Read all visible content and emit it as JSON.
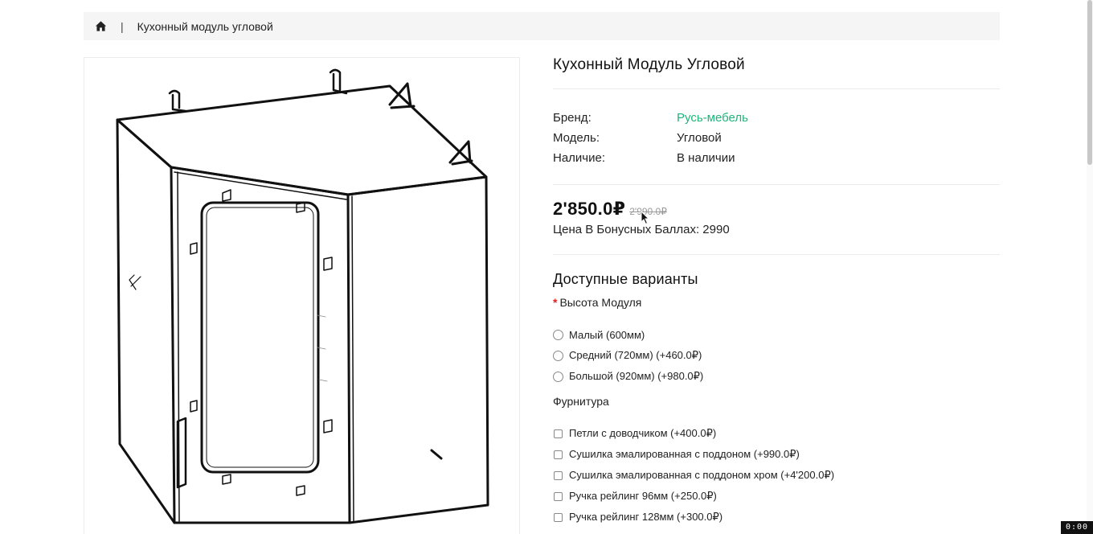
{
  "breadcrumb": {
    "home_icon": "home-icon",
    "separator": "|",
    "current": "Кухонный модуль угловой"
  },
  "product": {
    "title": "Кухонный Модуль Угловой",
    "image_alt": "corner kitchen cabinet line drawing",
    "specs": [
      {
        "label": "Бренд:",
        "value": "Русь-мебель"
      },
      {
        "label": "Модель:",
        "value": "Угловой"
      },
      {
        "label": "Наличие:",
        "value": "В наличии"
      }
    ],
    "price_new": "2'850.0₽",
    "price_old": "2'990.0₽",
    "bonus": "Цена В Бонусных Баллах: 2990"
  },
  "options": {
    "title": "Доступные варианты",
    "height": {
      "required_mark": "*",
      "label": "Высота Модуля",
      "choices": [
        "Малый (600мм)",
        "Средний (720мм) (+460.0₽)",
        "Большой (920мм) (+980.0₽)"
      ]
    },
    "hardware": {
      "label": "Фурнитура",
      "choices": [
        "Петли с доводчиком (+400.0₽)",
        "Сушилка эмалированная с поддоном (+990.0₽)",
        "Сушилка эмалированная с поддоном хром (+4'200.0₽)",
        "Ручка рейлинг 96мм (+250.0₽)",
        "Ручка рейлинг 128мм (+300.0₽)"
      ]
    }
  },
  "overlay": {
    "timer": "0:00"
  },
  "colors": {
    "brand_link": "#1fb57a",
    "required": "#e02020",
    "breadcrumb_bg": "#f5f5f5"
  }
}
